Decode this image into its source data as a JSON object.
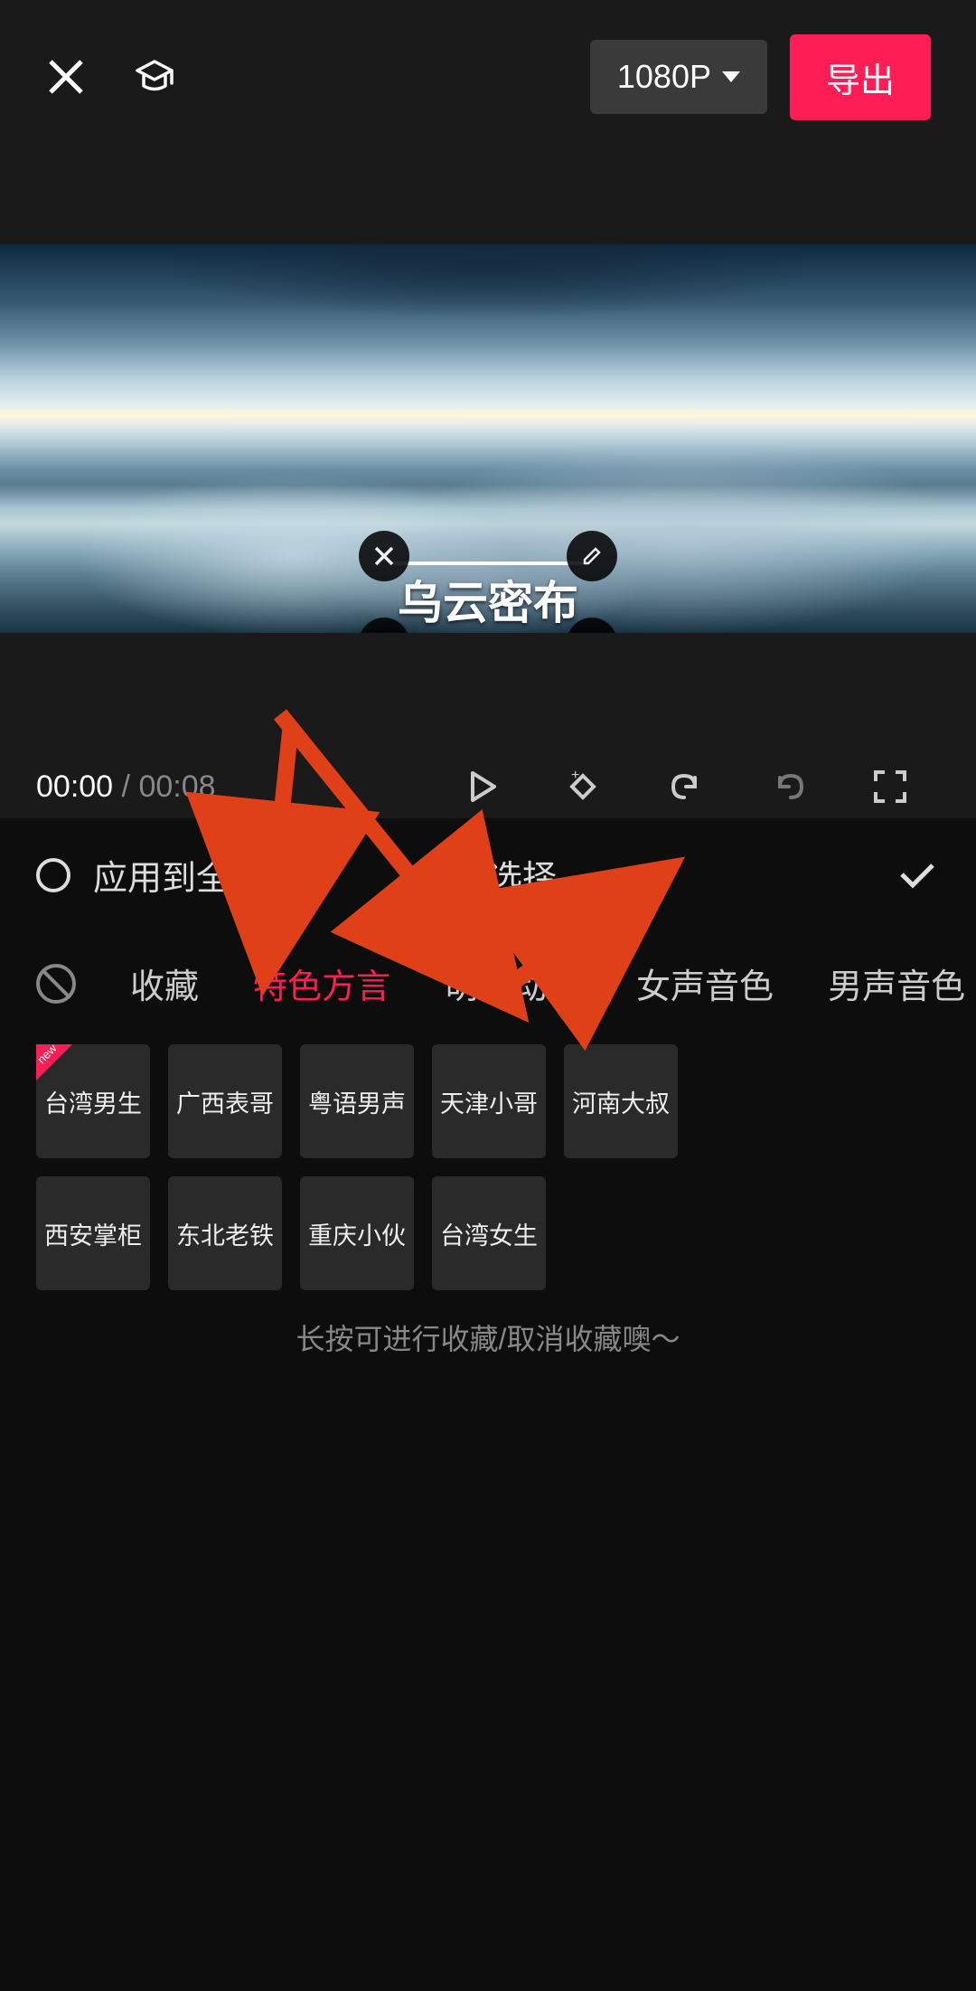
{
  "topbar": {
    "resolution_label": "1080P",
    "export_label": "导出"
  },
  "overlay": {
    "text": "乌云密布"
  },
  "playback": {
    "current_time": "00:00",
    "total_time": "00:08"
  },
  "voice_panel": {
    "apply_all_label": "应用到全部文本",
    "title": "音色选择"
  },
  "categories": [
    {
      "label": "收藏",
      "active": false
    },
    {
      "label": "特色方言",
      "active": true
    },
    {
      "label": "萌趣动漫",
      "active": false
    },
    {
      "label": "女声音色",
      "active": false
    },
    {
      "label": "男声音色",
      "active": false
    }
  ],
  "voices": [
    {
      "label": "台湾男生",
      "is_new": true
    },
    {
      "label": "广西表哥",
      "is_new": false
    },
    {
      "label": "粤语男声",
      "is_new": false
    },
    {
      "label": "天津小哥",
      "is_new": false
    },
    {
      "label": "河南大叔",
      "is_new": false
    },
    {
      "label": "西安掌柜",
      "is_new": false
    },
    {
      "label": "东北老铁",
      "is_new": false
    },
    {
      "label": "重庆小伙",
      "is_new": false
    },
    {
      "label": "台湾女生",
      "is_new": false
    }
  ],
  "hint": "长按可进行收藏/取消收藏噢～",
  "colors": {
    "accent": "#FF1D55",
    "annotation": "#E04018"
  }
}
